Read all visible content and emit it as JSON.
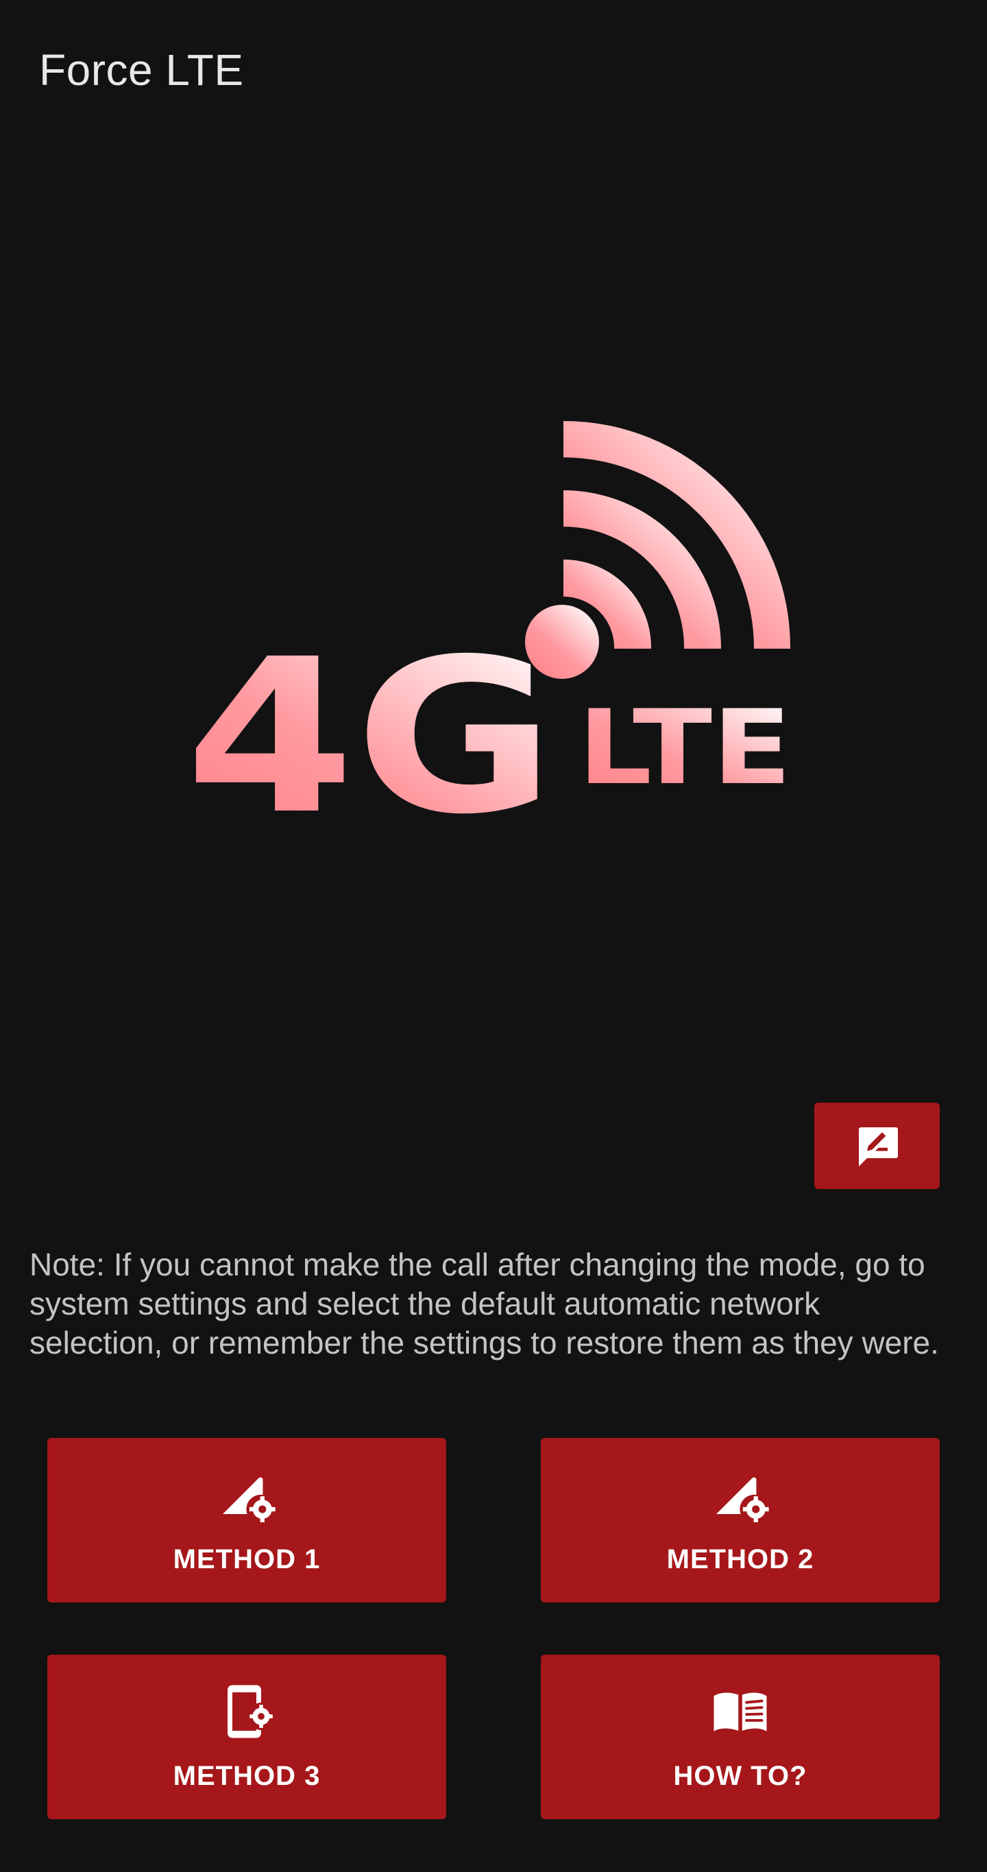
{
  "app_bar": {
    "title": "Force LTE"
  },
  "hero": {
    "logo_text_main": "4G",
    "logo_text_sub": "LTE",
    "gradient_start": "#ff7f86",
    "gradient_end": "#ffffff"
  },
  "feedback": {
    "icon": "feedback-icon"
  },
  "note": {
    "text": "Note: If you cannot make the call after changing the mode, go to system settings and select the default automatic network selection, or remember the settings to restore them as they were."
  },
  "actions": {
    "method1": {
      "label": "METHOD 1",
      "icon": "signal-settings-icon"
    },
    "method2": {
      "label": "METHOD 2",
      "icon": "signal-settings-icon"
    },
    "method3": {
      "label": "METHOD 3",
      "icon": "phone-settings-icon"
    },
    "how_to": {
      "label": "HOW TO?",
      "icon": "book-icon"
    }
  },
  "colors": {
    "background": "#121212",
    "accent": "#a5171a",
    "title_text": "#e8e8e8",
    "note_text": "#c4c4c4"
  }
}
